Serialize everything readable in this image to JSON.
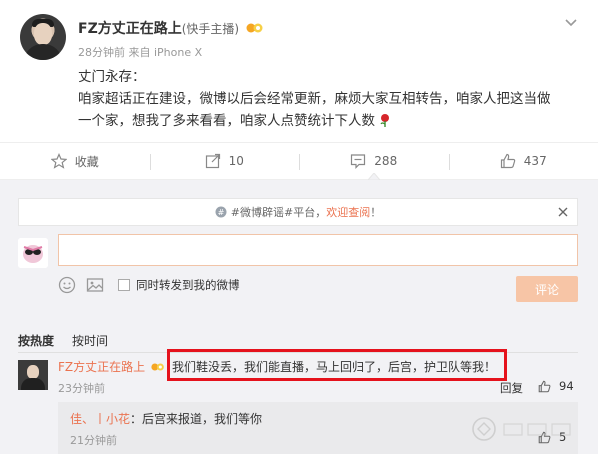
{
  "post": {
    "author": "FZ方丈正在路上",
    "author_role": "(快手主播)",
    "time": "28分钟前",
    "source": "来自 iPhone X",
    "lines": [
      "丈门永存：",
      "咱家超话正在建设，微博以后会经常更新，麻烦大家互相转告，咱家人把这当做",
      "一个家，想我了多来看看，咱家人点赞统计下人数"
    ]
  },
  "actions": {
    "favorite": "收藏",
    "repost": "10",
    "comment": "288",
    "like": "437"
  },
  "composer": {
    "notice_prefix": "#微博辟谣#平台，",
    "notice_link": "欢迎查阅",
    "notice_suffix": "！",
    "also_repost": "同时转发到我的微博",
    "submit": "评论"
  },
  "list": {
    "sort_hot": "按热度",
    "sort_time": "按时间"
  },
  "comments": [
    {
      "user": "FZ方丈正在路上",
      "text": "我们鞋没丢，我们能直播，马上回归了，后宫，护卫队等我！",
      "time": "23分钟前",
      "reply": "回复",
      "likes": "94"
    }
  ],
  "subreply": {
    "user": "佳、丨小花",
    "text": "：后宫来报道，我们等你",
    "time": "21分钟前",
    "likes": "5"
  },
  "colors": {
    "accent": "#eb7350",
    "highlight": "#e5121c",
    "submit_disabled": "#f7c5a6",
    "panel": "#f2f2f5"
  }
}
